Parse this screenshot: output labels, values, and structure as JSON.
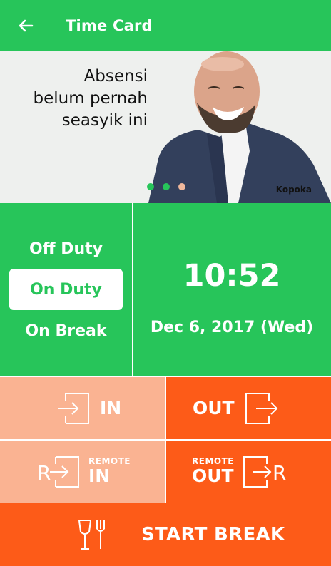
{
  "header": {
    "title": "Time Card"
  },
  "banner": {
    "lines": [
      "Absensi",
      "belum pernah",
      "seasyik ini"
    ],
    "brand": "Kopoka",
    "slides": 3,
    "active_slide": 0
  },
  "status": {
    "options": [
      "Off Duty",
      "On Duty",
      "On Break"
    ],
    "selected": "On Duty"
  },
  "clock": {
    "time": "10:52",
    "date": "Dec 6, 2017 (Wed)"
  },
  "actions": {
    "in": {
      "label": "IN"
    },
    "out": {
      "label": "OUT"
    },
    "remote_in": {
      "tag": "REMOTE",
      "label": "IN"
    },
    "remote_out": {
      "tag": "REMOTE",
      "label": "OUT"
    },
    "start_break": {
      "label": "START BREAK"
    }
  },
  "colors": {
    "green": "#27c55a",
    "orange": "#fd5b18",
    "peach": "#fab392"
  }
}
